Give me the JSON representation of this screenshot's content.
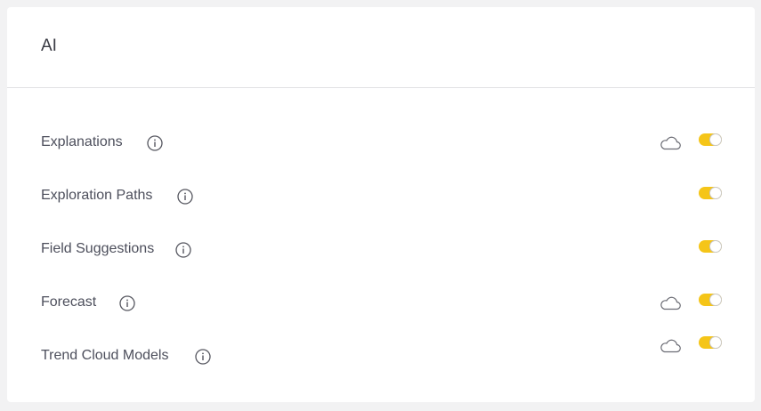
{
  "section": {
    "title": "AI"
  },
  "settings": [
    {
      "label": "Explanations",
      "info_icon": "info-icon",
      "cloud": true,
      "enabled": true
    },
    {
      "label": "Exploration Paths",
      "info_icon": "info-icon",
      "cloud": false,
      "enabled": true
    },
    {
      "label": "Field Suggestions",
      "info_icon": "info-icon",
      "cloud": false,
      "enabled": true
    },
    {
      "label": "Forecast",
      "info_icon": "info-icon",
      "cloud": true,
      "enabled": true
    },
    {
      "label": "Trend Cloud Models",
      "info_icon": "info-icon",
      "cloud": true,
      "enabled": true
    }
  ],
  "colors": {
    "toggle_on": "#f5c518",
    "background": "#f2f2f3",
    "card": "#ffffff",
    "text": "#4d4f5c"
  }
}
